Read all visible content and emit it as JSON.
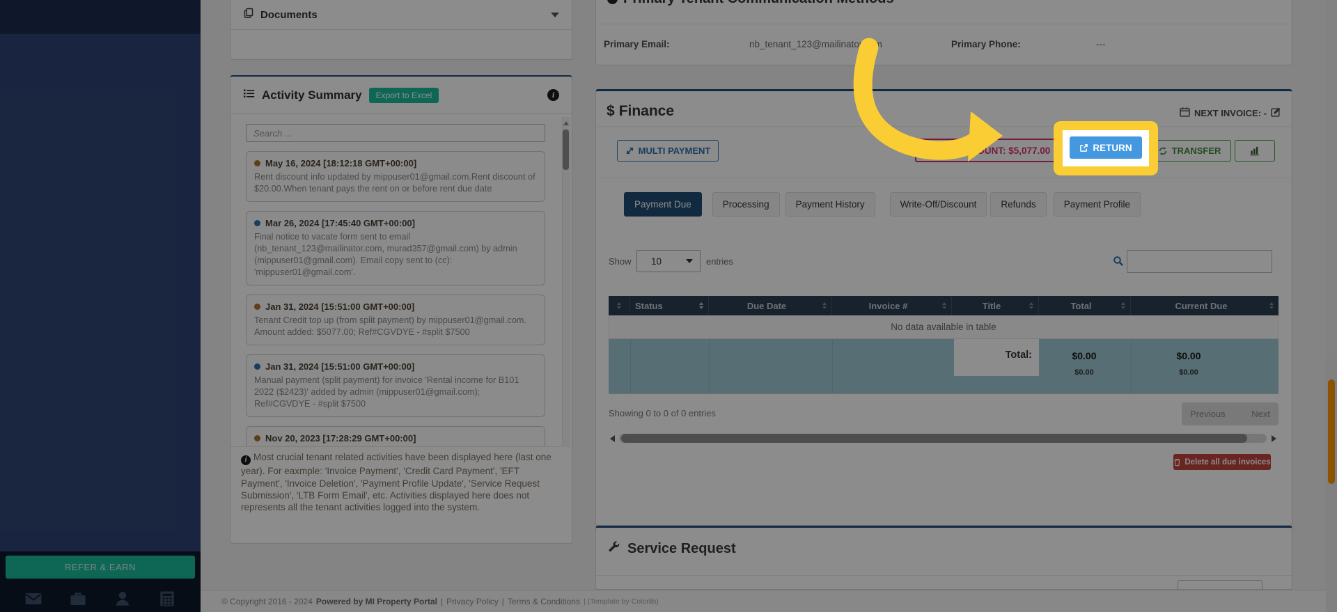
{
  "colors": {
    "accent-yellow": "#facd35",
    "return-blue": "#4498e0",
    "brand-navy": "#1f4e79",
    "turquoise": "#1abc9c",
    "credit-pink": "#d6336c",
    "success-green": "#449d44",
    "danger-red": "#c0443e",
    "total-row-teal": "#9ec8d6",
    "table-header": "#2c3e50"
  },
  "sidebar": {
    "refer_earn": "REFER & EARN"
  },
  "documents": {
    "title": "Documents"
  },
  "activity": {
    "title": "Activity Summary",
    "export_label": "Export to Excel",
    "search_placeholder": "Search ...",
    "entries": [
      {
        "date": "May 16, 2024 [18:12:18 GMT+00:00]",
        "dot": "#a9742c",
        "body": "Rent discount info updated by mippuser01@gmail.com.Rent discount of $20.00.When tenant pays the rent on or before rent due date"
      },
      {
        "date": "Mar 26, 2024 [17:45:40 GMT+00:00]",
        "dot": "#2f6fad",
        "body": "Final notice to vacate form sent to email (nb_tenant_123@mailinator.com, murad357@gmail.com) by admin (mippuser01@gmail.com). Email copy sent to (cc): 'mippuser01@gmail.com'."
      },
      {
        "date": "Jan 31, 2024 [15:51:00 GMT+00:00]",
        "dot": "#a9742c",
        "body": "Tenant Credit top up (from split payment) by mippuser01@gmail.com. Amount added: $5077.00; Ref#CGVDYE - #split $7500"
      },
      {
        "date": "Jan 31, 2024 [15:51:00 GMT+00:00]",
        "dot": "#2f6fad",
        "body": "Manual payment (split payment) for invoice 'Rental income for B101 2022 ($2423)' added by admin (mippuser01@gmail.com); Ref#CGVDYE - #split $7500"
      },
      {
        "date": "Nov 20, 2023 [17:28:29 GMT+00:00]",
        "dot": "#a9742c",
        "body": ""
      }
    ],
    "info_note": "Most crucial tenant related activities have been displayed here (last one year). For eaxmple: 'Invoice Payment', 'Credit Card Payment', 'EFT Payment', 'Invoice Deletion', 'Payment Profile Update', 'Service Request Submission', 'LTB Form Email', etc. Activities displayed here does not represents all the tenant activities logged into the system."
  },
  "communication": {
    "title": "Primary Tenant Communication Methods",
    "email_label": "Primary Email:",
    "email_value": "nb_tenant_123@mailinator.com",
    "phone_label": "Primary Phone:",
    "phone_value": "---"
  },
  "finance": {
    "dollar_icon": "$",
    "title": "Finance",
    "next_invoice": "NEXT INVOICE: -",
    "buttons": {
      "multi_payment": "MULTI PAYMENT",
      "credit_amount": "CREDIT AMOUNT: $5,077.00",
      "return_label": "RETURN",
      "transfer": "TRANSFER"
    },
    "tabs": [
      {
        "label": "Payment Due"
      },
      {
        "label": "Processing"
      },
      {
        "label": "Payment History"
      },
      {
        "label": "Write-Off/Discount"
      },
      {
        "label": "Refunds"
      },
      {
        "label": "Payment Profile"
      }
    ],
    "show_label": "Show",
    "page_size": "10",
    "entries_label": "entries",
    "table": {
      "headers": [
        "",
        "Status",
        "Due Date",
        "Invoice #",
        "Title",
        "Total",
        "Current Due"
      ],
      "empty_text": "No data available in table",
      "total_label": "Total:",
      "total_main": "$0.00",
      "total_sub": "$0.00",
      "current_due_main": "$0.00",
      "current_due_sub": "$0.00"
    },
    "showing_text": "Showing 0 to 0 of 0 entries",
    "prev_label": "Previous",
    "next_label": "Next",
    "delete_label": "Delete all due invoices"
  },
  "service": {
    "title": "Service Request"
  },
  "footer": {
    "copyright": "© Copyright 2016 - 2024",
    "powered": "Powered by MI Property Portal",
    "sep": "|",
    "privacy": "Privacy Policy",
    "terms": "Terms & Conditions",
    "template_note": "| (Template by Colorlib)"
  }
}
